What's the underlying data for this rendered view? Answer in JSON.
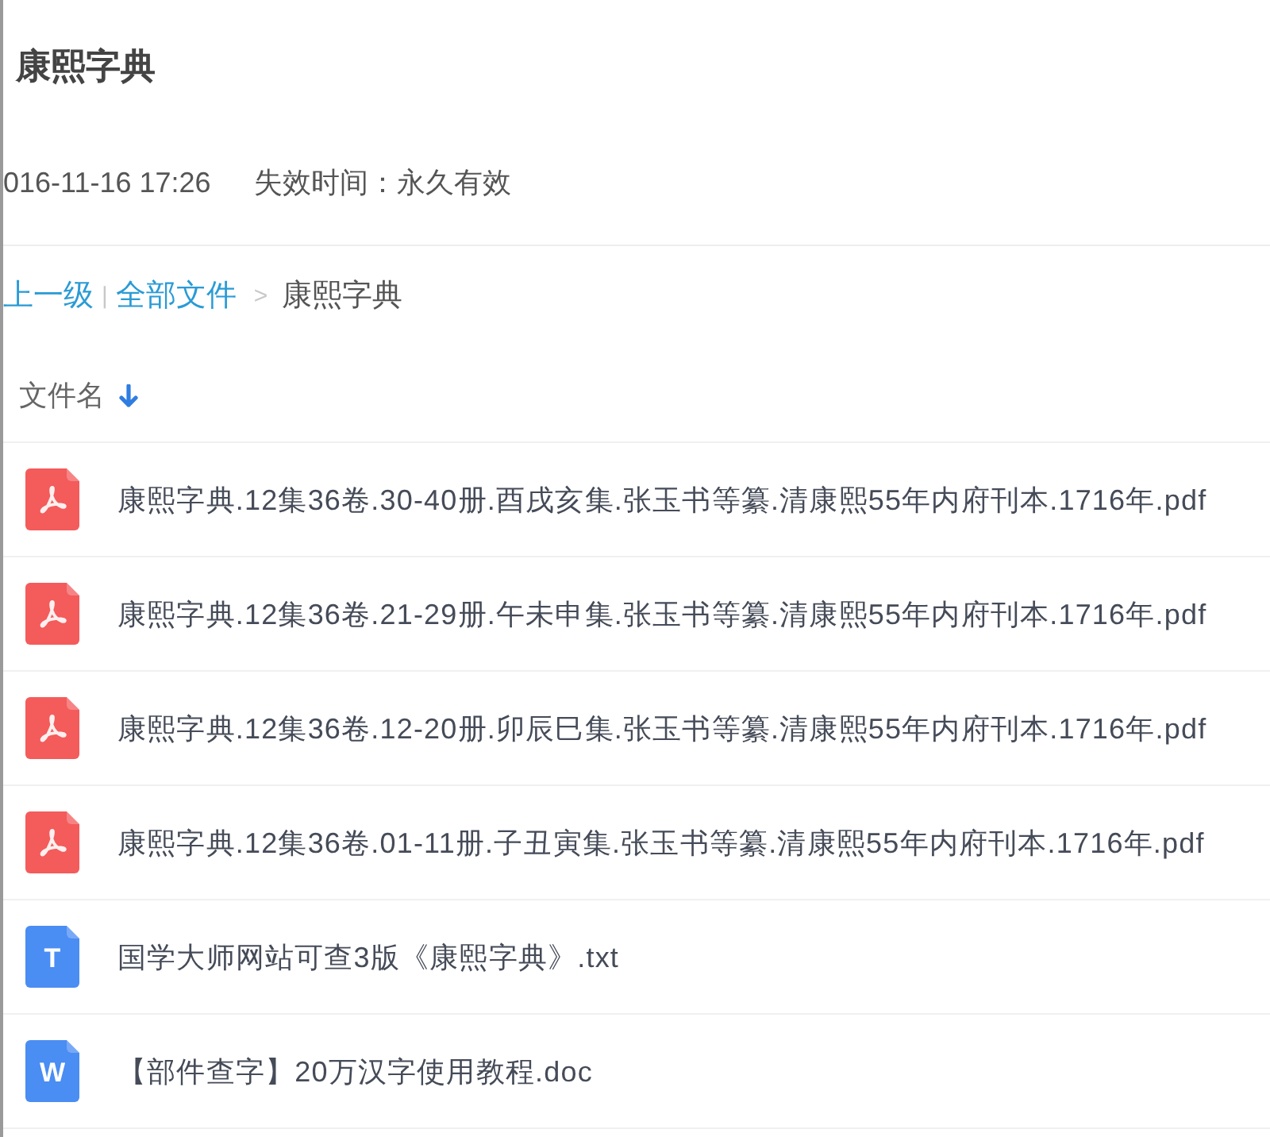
{
  "title": "康熙字典",
  "meta": {
    "share_time": "016-11-16 17:26",
    "expiry": "失效时间：永久有效"
  },
  "breadcrumb": [
    {
      "kind": "link",
      "label": "上一级"
    },
    {
      "kind": "divider",
      "label": "|"
    },
    {
      "kind": "link",
      "label": "全部文件"
    },
    {
      "kind": "separator",
      "label": ">"
    },
    {
      "kind": "current",
      "label": "康熙字典"
    }
  ],
  "file_list": {
    "column": "文件名",
    "sort_descending": true,
    "files": [
      {
        "kind": "pdf",
        "name": "康熙字典.12集36卷.30-40册.酉戌亥集.张玉书等纂.清康熙55年内府刊本.1716年.pdf"
      },
      {
        "kind": "pdf",
        "name": "康熙字典.12集36卷.21-29册.午未申集.张玉书等纂.清康熙55年内府刊本.1716年.pdf"
      },
      {
        "kind": "pdf",
        "name": "康熙字典.12集36卷.12-20册.卯辰巳集.张玉书等纂.清康熙55年内府刊本.1716年.pdf"
      },
      {
        "kind": "pdf",
        "name": "康熙字典.12集36卷.01-11册.子丑寅集.张玉书等纂.清康熙55年内府刊本.1716年.pdf"
      },
      {
        "kind": "txt",
        "icon_letter": "T",
        "name": "国学大师网站可查3版《康熙字典》.txt"
      },
      {
        "kind": "doc",
        "icon_letter": "W",
        "name": "【部件查字】20万汉字使用教程.doc"
      }
    ]
  }
}
